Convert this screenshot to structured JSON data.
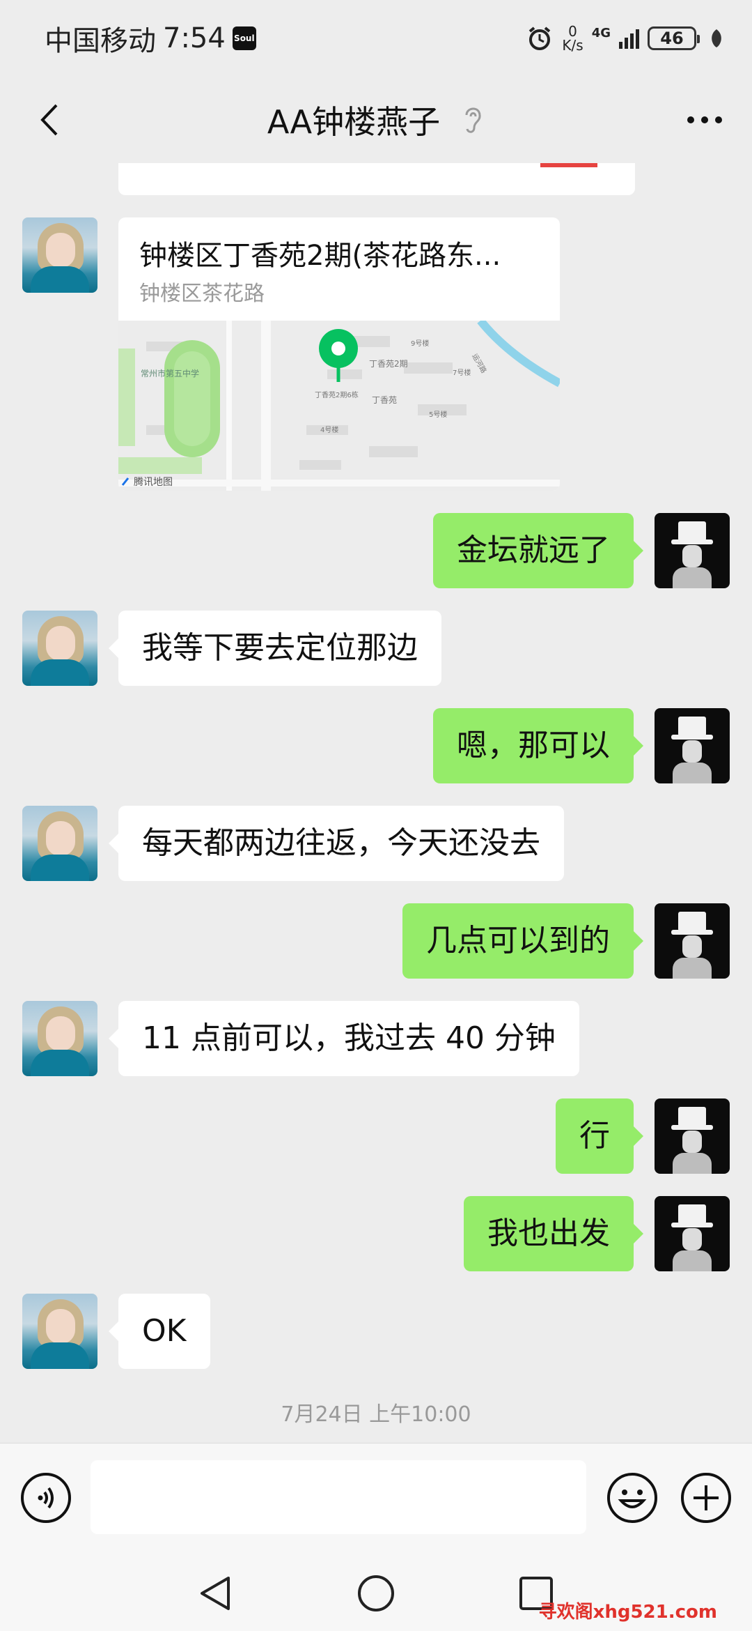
{
  "status_bar": {
    "carrier": "中国移动",
    "time": "7:54",
    "app_badge": "Soul",
    "net_speed_value": "0",
    "net_speed_unit": "K/s",
    "network_type": "4G",
    "battery": "46"
  },
  "nav": {
    "title": "AA钟楼燕子"
  },
  "location": {
    "title": "钟楼区丁香苑2期(茶花路东...",
    "subtitle": "钟楼区茶花路",
    "map_labels": {
      "school": "常州市第五中学",
      "l1": "9号楼",
      "l2": "丁香苑2期",
      "l3": "7号楼",
      "l4": "丁香苑2期6栋",
      "l5": "丁香苑",
      "l6": "5号楼",
      "l7": "4号楼",
      "l8": "运河路",
      "brand": "腾讯地图"
    }
  },
  "messages": [
    {
      "side": "out",
      "text": "金坛就远了"
    },
    {
      "side": "in",
      "text": "我等下要去定位那边"
    },
    {
      "side": "out",
      "text": "嗯，那可以"
    },
    {
      "side": "in",
      "text": "每天都两边往返，今天还没去"
    },
    {
      "side": "out",
      "text": "几点可以到的"
    },
    {
      "side": "in",
      "text": "11 点前可以，我过去 40 分钟"
    },
    {
      "side": "out",
      "text": "行"
    },
    {
      "side": "out",
      "text": "我也出发"
    },
    {
      "side": "in",
      "text": "OK"
    }
  ],
  "timestamp": "7月24日 上午10:00",
  "input": {
    "placeholder": ""
  },
  "watermark": "寻欢阁xhg521.com",
  "colors": {
    "background": "#ededed",
    "outgoing_bubble": "#95ec69",
    "incoming_bubble": "#ffffff",
    "pin": "#07c160",
    "watermark": "#e0322c"
  },
  "icons": {
    "back": "chevron-left-icon",
    "mute": "ear-icon",
    "more": "more-dots-icon",
    "voice": "voice-icon",
    "emoji": "emoji-icon",
    "add": "plus-circle-icon",
    "alarm": "alarm-icon",
    "leaf": "leaf-icon"
  }
}
